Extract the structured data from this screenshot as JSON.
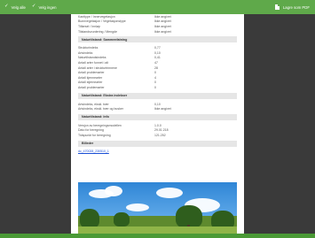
{
  "toolbar": {
    "select_all": "Velg alle",
    "deselect_all": "Velg ingen",
    "save_pdf": "Lagre som PDF"
  },
  "top_rows": [
    {
      "key": "Kanttype / Innervegetasjon",
      "value": "Ikke angivet"
    },
    {
      "key": "Bunnvegetasjon / Vegetasjonstype",
      "value": "Ikke angivet"
    },
    {
      "key": "Tilførsel / Innløp",
      "value": "Ikke angivet"
    },
    {
      "key": "Tilstandsvurdering / Mengde",
      "value": "Ikke angivet"
    }
  ],
  "sections": {
    "natur_detail": {
      "title": "Naturtilstand: Sammenfatning",
      "rows": [
        {
          "key": "Strukturindeks",
          "value": "0,77"
        },
        {
          "key": "Artsindeks",
          "value": "0,10"
        },
        {
          "key": "Naturtilstandsindeks",
          "value": "0,41"
        },
        {
          "key": "Antall arter funnet i alt",
          "value": "47"
        },
        {
          "key": "Antall arter i strukturtrinnene",
          "value": "28"
        },
        {
          "key": "Antall problemarter",
          "value": "0"
        },
        {
          "key": "Antall kjennearter",
          "value": "4"
        },
        {
          "key": "Antall stjernearter",
          "value": "0"
        },
        {
          "key": "Antall problemarter",
          "value": "0"
        }
      ]
    },
    "natur_calc": {
      "title": "Naturtilstand: Ekstra indekser",
      "rows": [
        {
          "key": "Artsindeks, ekskl. trær",
          "value": "0,10"
        },
        {
          "key": "Artsindeks, ekskl. trær og busker",
          "value": "Ikke angivet"
        }
      ]
    },
    "natur_info": {
      "title": "Naturtilstand: Info",
      "rows": [
        {
          "key": "Versjon av beregningsmodellen",
          "value": "1.0.0"
        },
        {
          "key": "Dato for beregning",
          "value": "29.01.218"
        },
        {
          "key": "Tidspunkt for beregning",
          "value": "121.252"
        }
      ]
    },
    "photos": {
      "title": "Billeder",
      "link": "dc_470028_230510_1"
    }
  }
}
